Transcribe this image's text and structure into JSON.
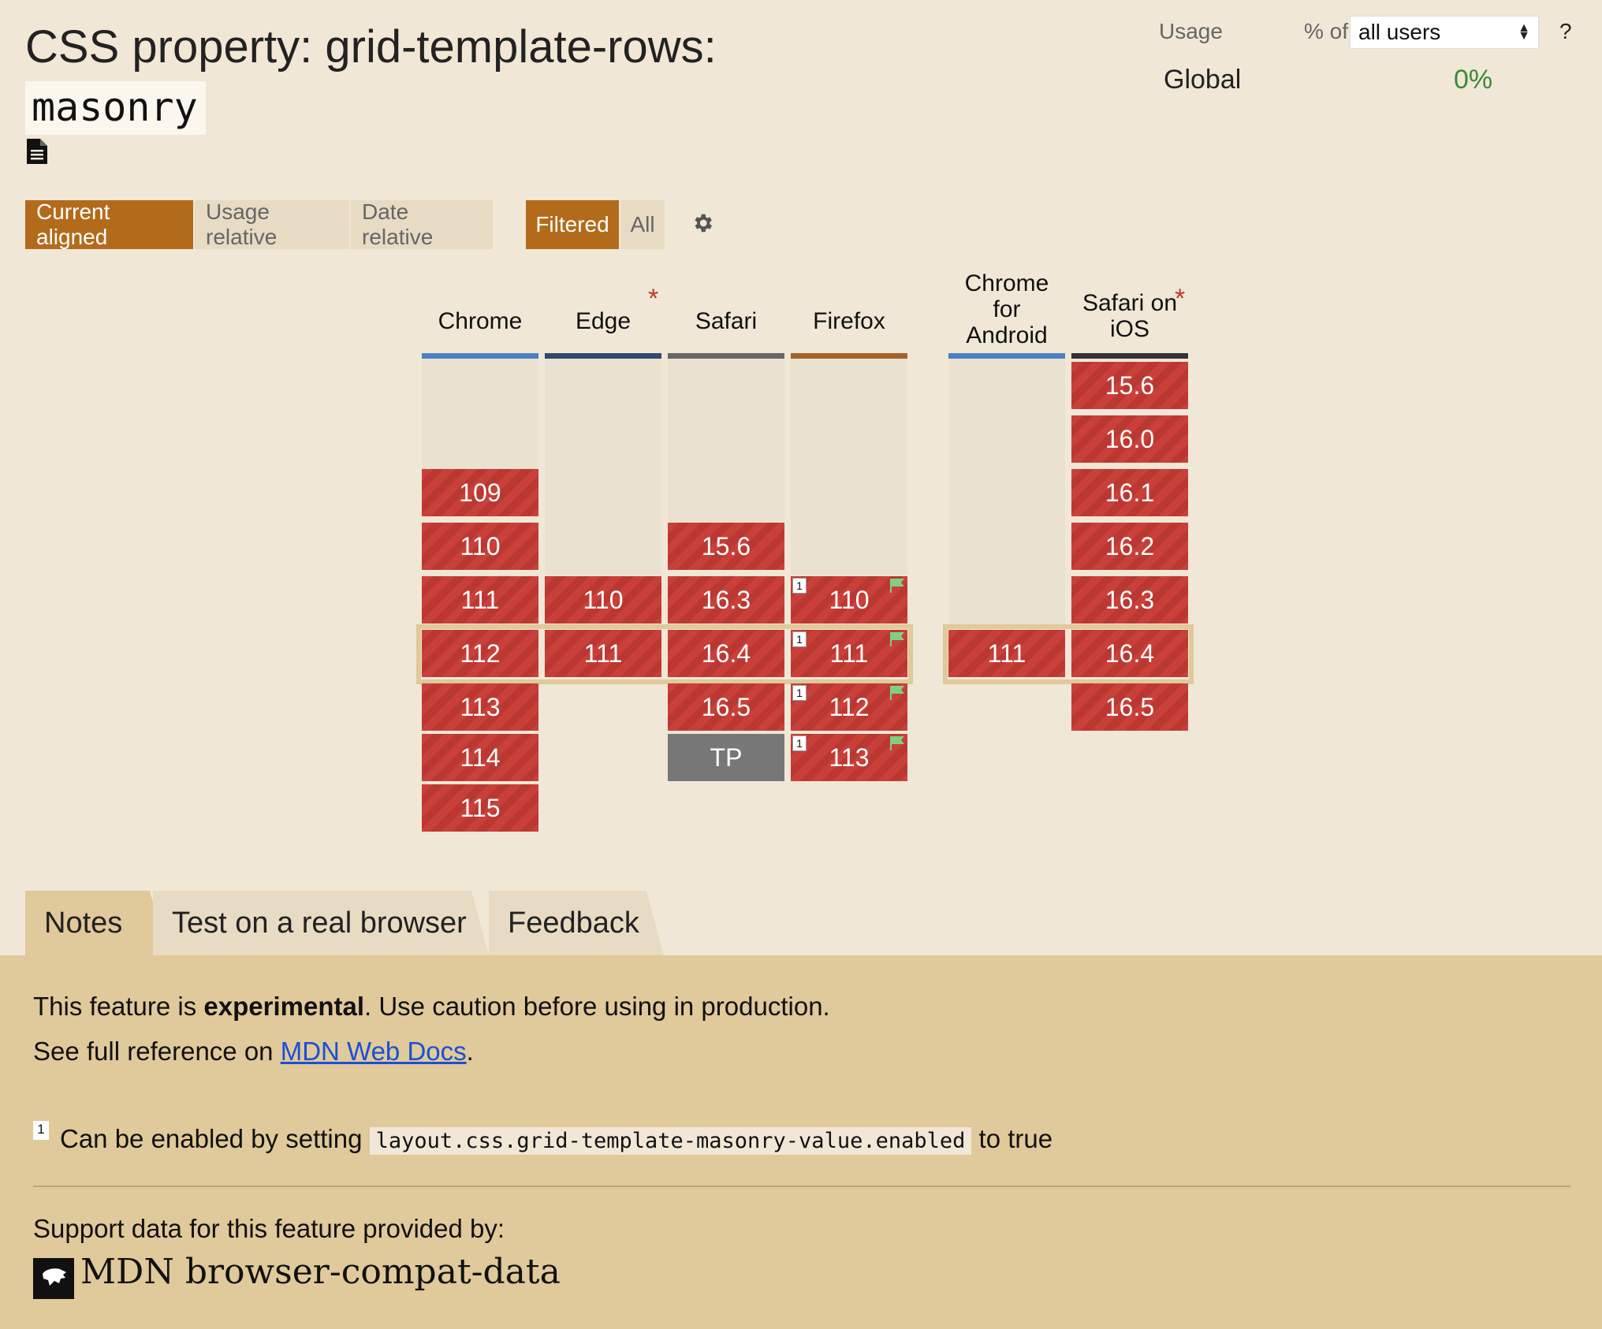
{
  "title": {
    "prefix": "CSS property: grid-template-rows:",
    "code": "masonry"
  },
  "usage": {
    "label": "Usage",
    "pct_of": "% of",
    "selected": "all users",
    "help": "?",
    "global_label": "Global",
    "global_value": "0%"
  },
  "view_buttons": [
    "Current aligned",
    "Usage relative",
    "Date relative"
  ],
  "filter_buttons": [
    "Filtered",
    "All"
  ],
  "browsers": {
    "chrome": {
      "name": "Chrome",
      "color": "#4a7fc1",
      "versions": [
        "109",
        "110",
        "111",
        "112",
        "113",
        "114",
        "115"
      ]
    },
    "edge": {
      "name": "Edge",
      "color": "#2f4a6e",
      "versions": [
        "110",
        "111"
      ]
    },
    "safari": {
      "name": "Safari",
      "color": "#666666",
      "versions": [
        "15.6",
        "16.3",
        "16.4",
        "16.5",
        "TP"
      ]
    },
    "firefox": {
      "name": "Firefox",
      "color": "#a4622a",
      "versions": [
        "110",
        "111",
        "112",
        "113"
      ]
    },
    "chrome_android": {
      "name_line1": "Chrome",
      "name_line2": "for",
      "name_line3": "Android",
      "color": "#4a7fc1",
      "versions": [
        "111"
      ]
    },
    "safari_ios": {
      "name_line1": "Safari on",
      "name_line2": "iOS",
      "color": "#333333",
      "versions": [
        "15.6",
        "16.0",
        "16.1",
        "16.2",
        "16.3",
        "16.4",
        "16.5"
      ]
    }
  },
  "note_marker": "1",
  "star": "*",
  "tabs": [
    "Notes",
    "Test on a real browser",
    "Feedback"
  ],
  "notes": {
    "line1_pre": "This feature is ",
    "line1_bold": "experimental",
    "line1_post": ". Use caution before using in production.",
    "line2_pre": "See full reference on ",
    "line2_link": "MDN Web Docs",
    "line2_post": ".",
    "footnote_num": "1",
    "footnote_pre": "Can be enabled by setting ",
    "footnote_code": "layout.css.grid-template-masonry-value.enabled",
    "footnote_post": " to true",
    "support_text": "Support data for this feature provided by:",
    "mdn_text": "MDN browser-compat-data"
  }
}
